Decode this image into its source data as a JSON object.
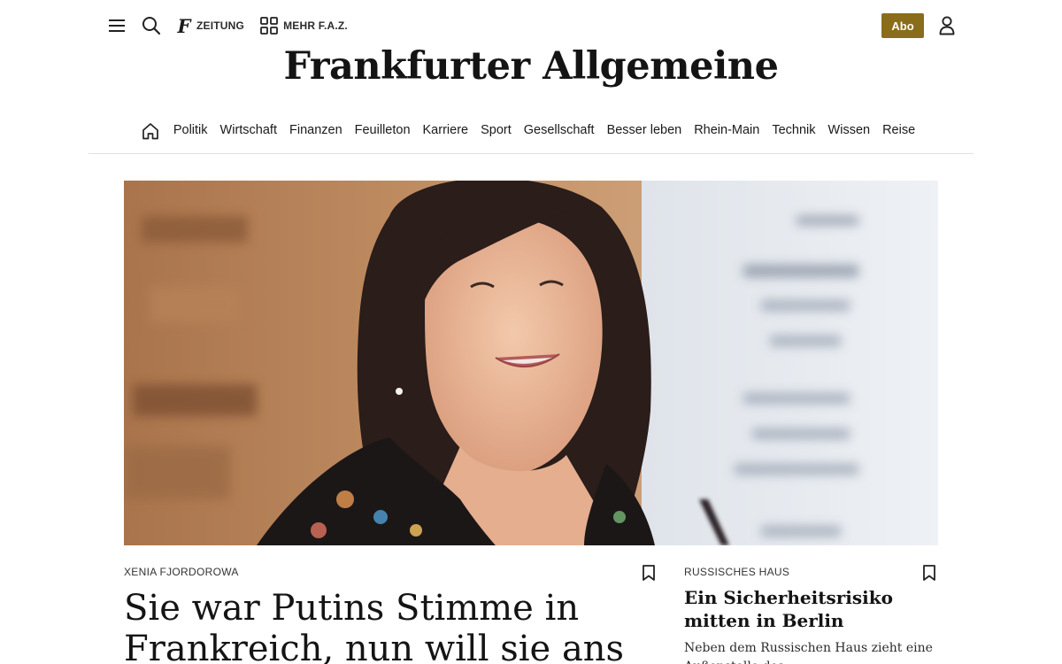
{
  "header": {
    "zeitung_label": "ZEITUNG",
    "mehr_label": "MEHR F.A.Z.",
    "abo_label": "Abo",
    "logo_text": "Frankfurter Allgemeine",
    "accent_color": "#8a6d1b"
  },
  "icons": {
    "menu": "menu-icon",
    "search": "search-icon",
    "zeitung": "faz-f-icon",
    "mehr": "grid-icon",
    "user": "user-icon",
    "home": "home-icon",
    "bookmark": "bookmark-icon"
  },
  "nav": {
    "items": [
      "Politik",
      "Wirtschaft",
      "Finanzen",
      "Feuilleton",
      "Karriere",
      "Sport",
      "Gesellschaft",
      "Besser leben",
      "Rhein-Main",
      "Technik",
      "Wissen",
      "Reise"
    ]
  },
  "main_article": {
    "kicker": "XENIA FJORDOROWA",
    "headline": "Sie war Putins Stimme in Frankreich, nun will sie ans"
  },
  "side_article": {
    "kicker": "RUSSISCHES HAUS",
    "headline": "Ein Sicherheitsrisiko mitten in Berlin",
    "teaser": "Neben dem Russischen Haus zieht eine Außenstelle des"
  }
}
